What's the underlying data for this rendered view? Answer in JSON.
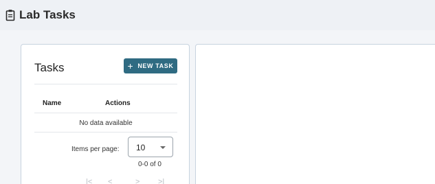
{
  "header": {
    "title": "Lab Tasks",
    "icon": "clipboard-icon"
  },
  "tasks_panel": {
    "title": "Tasks",
    "new_task_button": {
      "icon": "plus-icon",
      "label": "NEW TASK"
    },
    "table": {
      "columns": [
        "Name",
        "Actions"
      ],
      "rows": [],
      "empty_text": "No data available"
    },
    "pagination": {
      "items_per_page_label": "Items per page:",
      "items_per_page_value": "10",
      "range_text": "0-0 of 0",
      "first_glyph": "|<",
      "prev_glyph": "<",
      "next_glyph": ">",
      "last_glyph": ">|"
    }
  },
  "colors": {
    "accent": "#2f6b82",
    "header_bg": "#eef1f5",
    "content_bg": "#f3f5f8",
    "card_border": "#c7d3df"
  }
}
